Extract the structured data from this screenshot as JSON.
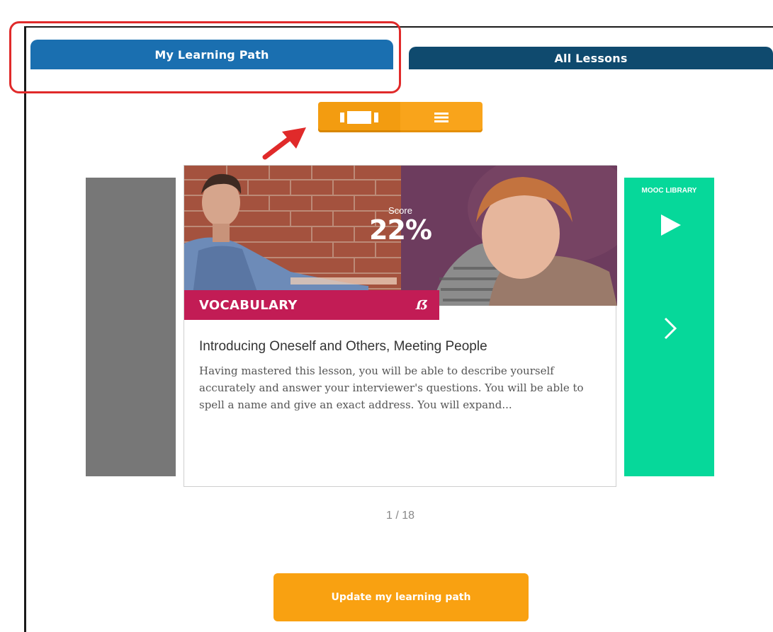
{
  "tabs": [
    {
      "label": "My Learning Path",
      "active": true
    },
    {
      "label": "All Lessons",
      "active": false
    }
  ],
  "view_toggle": {
    "options": [
      {
        "icon": "card-view-icon",
        "active": true
      },
      {
        "icon": "list-view-icon",
        "active": false
      }
    ]
  },
  "lesson": {
    "score_label": "Score",
    "score_value": "22%",
    "category": "VOCABULARY",
    "category_icon": "ab-icon",
    "title": "Introducing Oneself and Others, Meeting People",
    "description": "Having mastered this lesson, you will be able to describe yourself accurately and answer your interviewer's questions. You will be able to spell a name and give an exact address. You will expand..."
  },
  "next_card": {
    "label": "MOOC LIBRARY",
    "icons": [
      "play-icon",
      "chevron-right-icon"
    ]
  },
  "pagination": "1 / 18",
  "update_button": "Update my learning path",
  "colors": {
    "tab_active": "#1a6fb0",
    "tab_inactive": "#0f4a6e",
    "toggle": "#f8a013",
    "category_band": "#c21c55",
    "next_card": "#06d89a",
    "prev_card": "#777777",
    "update_button": "#f9a111",
    "highlight": "#e02a2a"
  }
}
